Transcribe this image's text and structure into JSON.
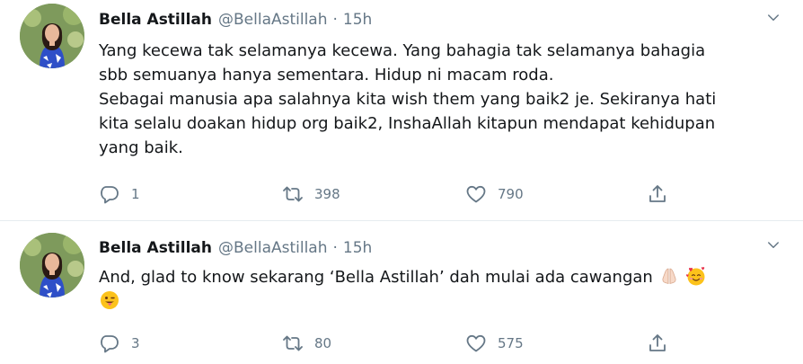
{
  "tweets": [
    {
      "name": "Bella Astillah",
      "handle": "@BellaAstillah",
      "separator": "·",
      "time": "15h",
      "text_lines": [
        "Yang kecewa tak selamanya kecewa. Yang bahagia tak selamanya bahagia",
        "sbb semuanya hanya sementara. Hidup ni macam roda.",
        "Sebagai manusia apa salahnya kita wish them yang baik2 je. Sekiranya hati",
        "kita selalu doakan hidup org baik2, InshaAllah kitapun mendapat kehidupan",
        "yang baik."
      ],
      "replies": "1",
      "retweets": "398",
      "likes": "790"
    },
    {
      "name": "Bella Astillah",
      "handle": "@BellaAstillah",
      "separator": "·",
      "time": "15h",
      "text_lines": [
        "And, glad to know sekarang ‘Bella Astillah’ dah mulai ada cawangan"
      ],
      "emojis": [
        "praying-hands-emoji",
        "smiling-face-with-hearts-emoji",
        "winking-face-with-tongue-emoji"
      ],
      "replies": "3",
      "retweets": "80",
      "likes": "575"
    }
  ],
  "icons": {
    "reply": "reply-icon",
    "retweet": "retweet-icon",
    "like": "heart-icon",
    "share": "share-icon",
    "caret": "chevron-down-icon"
  },
  "colors": {
    "text": "#14171a",
    "muted": "#657786",
    "divider": "#e6ecf0"
  }
}
